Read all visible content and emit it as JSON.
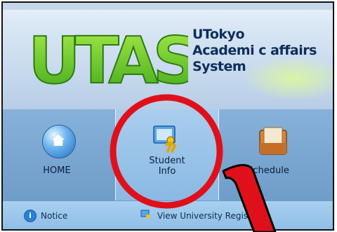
{
  "header": {
    "logo_text": "UTAS",
    "title_lines": [
      "UTokyo",
      "Academi c affairs",
      "System"
    ]
  },
  "tabs": [
    {
      "label": "HOME",
      "icon": "home-icon"
    },
    {
      "label_line1": "Student",
      "label_line2": "Info",
      "icon": "student-icon",
      "selected": true
    },
    {
      "label": "Schedule",
      "icon": "schedule-icon"
    }
  ],
  "subnav": {
    "notice": "Notice",
    "view_registration": "View University Regist"
  },
  "colors": {
    "header_bg": "#c9dbee",
    "tabbar_bg": "#7da9d3",
    "selected_tab_bg": "#a9cdee",
    "annotation_red": "#e0101a",
    "logo_green": "#6ccf2a"
  }
}
